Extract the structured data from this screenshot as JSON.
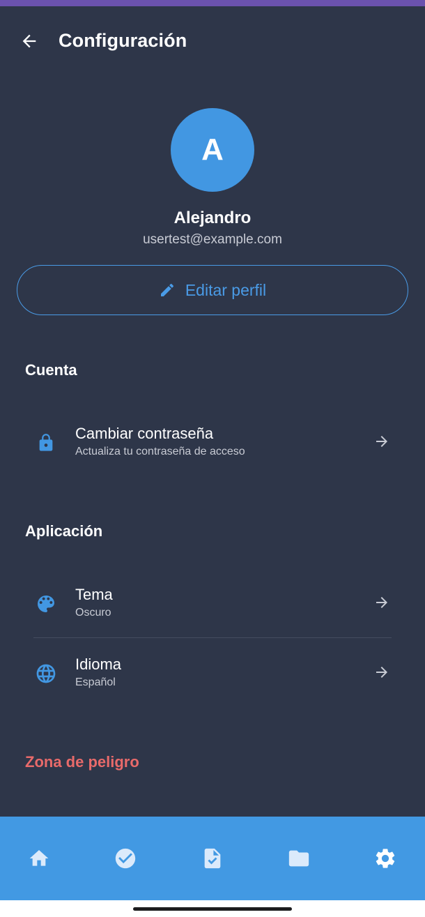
{
  "header": {
    "title": "Configuración",
    "back_icon": "arrow-left-icon"
  },
  "profile": {
    "avatar_initial": "A",
    "name": "Alejandro",
    "email": "usertest@example.com",
    "edit_label": "Editar perfil",
    "edit_icon": "pencil-icon"
  },
  "sections": {
    "account": {
      "title": "Cuenta",
      "items": [
        {
          "icon": "lock-icon",
          "title": "Cambiar contraseña",
          "subtitle": "Actualiza tu contraseña de acceso"
        }
      ]
    },
    "application": {
      "title": "Aplicación",
      "items": [
        {
          "icon": "palette-icon",
          "title": "Tema",
          "subtitle": "Oscuro"
        },
        {
          "icon": "globe-icon",
          "title": "Idioma",
          "subtitle": "Español"
        }
      ]
    },
    "danger": {
      "title": "Zona de peligro"
    }
  },
  "bottom_nav": {
    "items": [
      {
        "icon": "home-icon"
      },
      {
        "icon": "check-circle-icon"
      },
      {
        "icon": "document-check-icon"
      },
      {
        "icon": "folder-icon"
      },
      {
        "icon": "gear-icon"
      }
    ]
  },
  "colors": {
    "background": "#2e3649",
    "accent": "#4297e2",
    "danger": "#e86a6a",
    "status_strip": "#6b52ae"
  }
}
